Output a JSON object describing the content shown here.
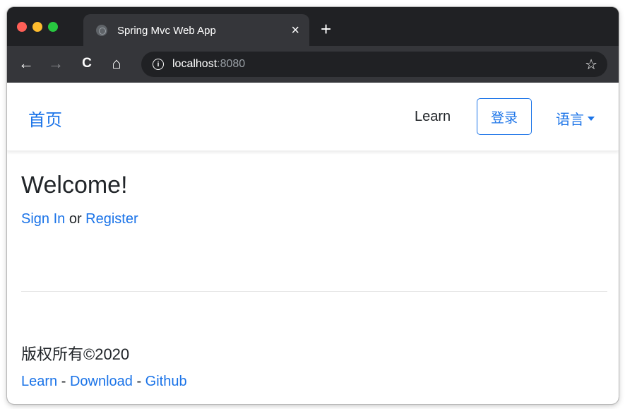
{
  "browser": {
    "tab_title": "Spring Mvc Web App",
    "tab_close": "×",
    "new_tab": "+",
    "url_host": "localhost",
    "url_port": ":8080",
    "icons": {
      "back": "←",
      "forward": "→",
      "reload": "C",
      "home": "⌂",
      "info": "i",
      "star": "☆"
    }
  },
  "navbar": {
    "brand": "首页",
    "learn": "Learn",
    "login": "登录",
    "language": "语言"
  },
  "main": {
    "welcome": "Welcome!",
    "sign_in": "Sign In",
    "or": " or ",
    "register": "Register"
  },
  "footer": {
    "copyright": "版权所有©2020",
    "learn": "Learn",
    "sep1": " - ",
    "download": "Download",
    "sep2": " - ",
    "github": "Github"
  },
  "colors": {
    "accent": "#1a73e8",
    "chrome_dark": "#202124",
    "chrome_tab": "#35363a"
  }
}
